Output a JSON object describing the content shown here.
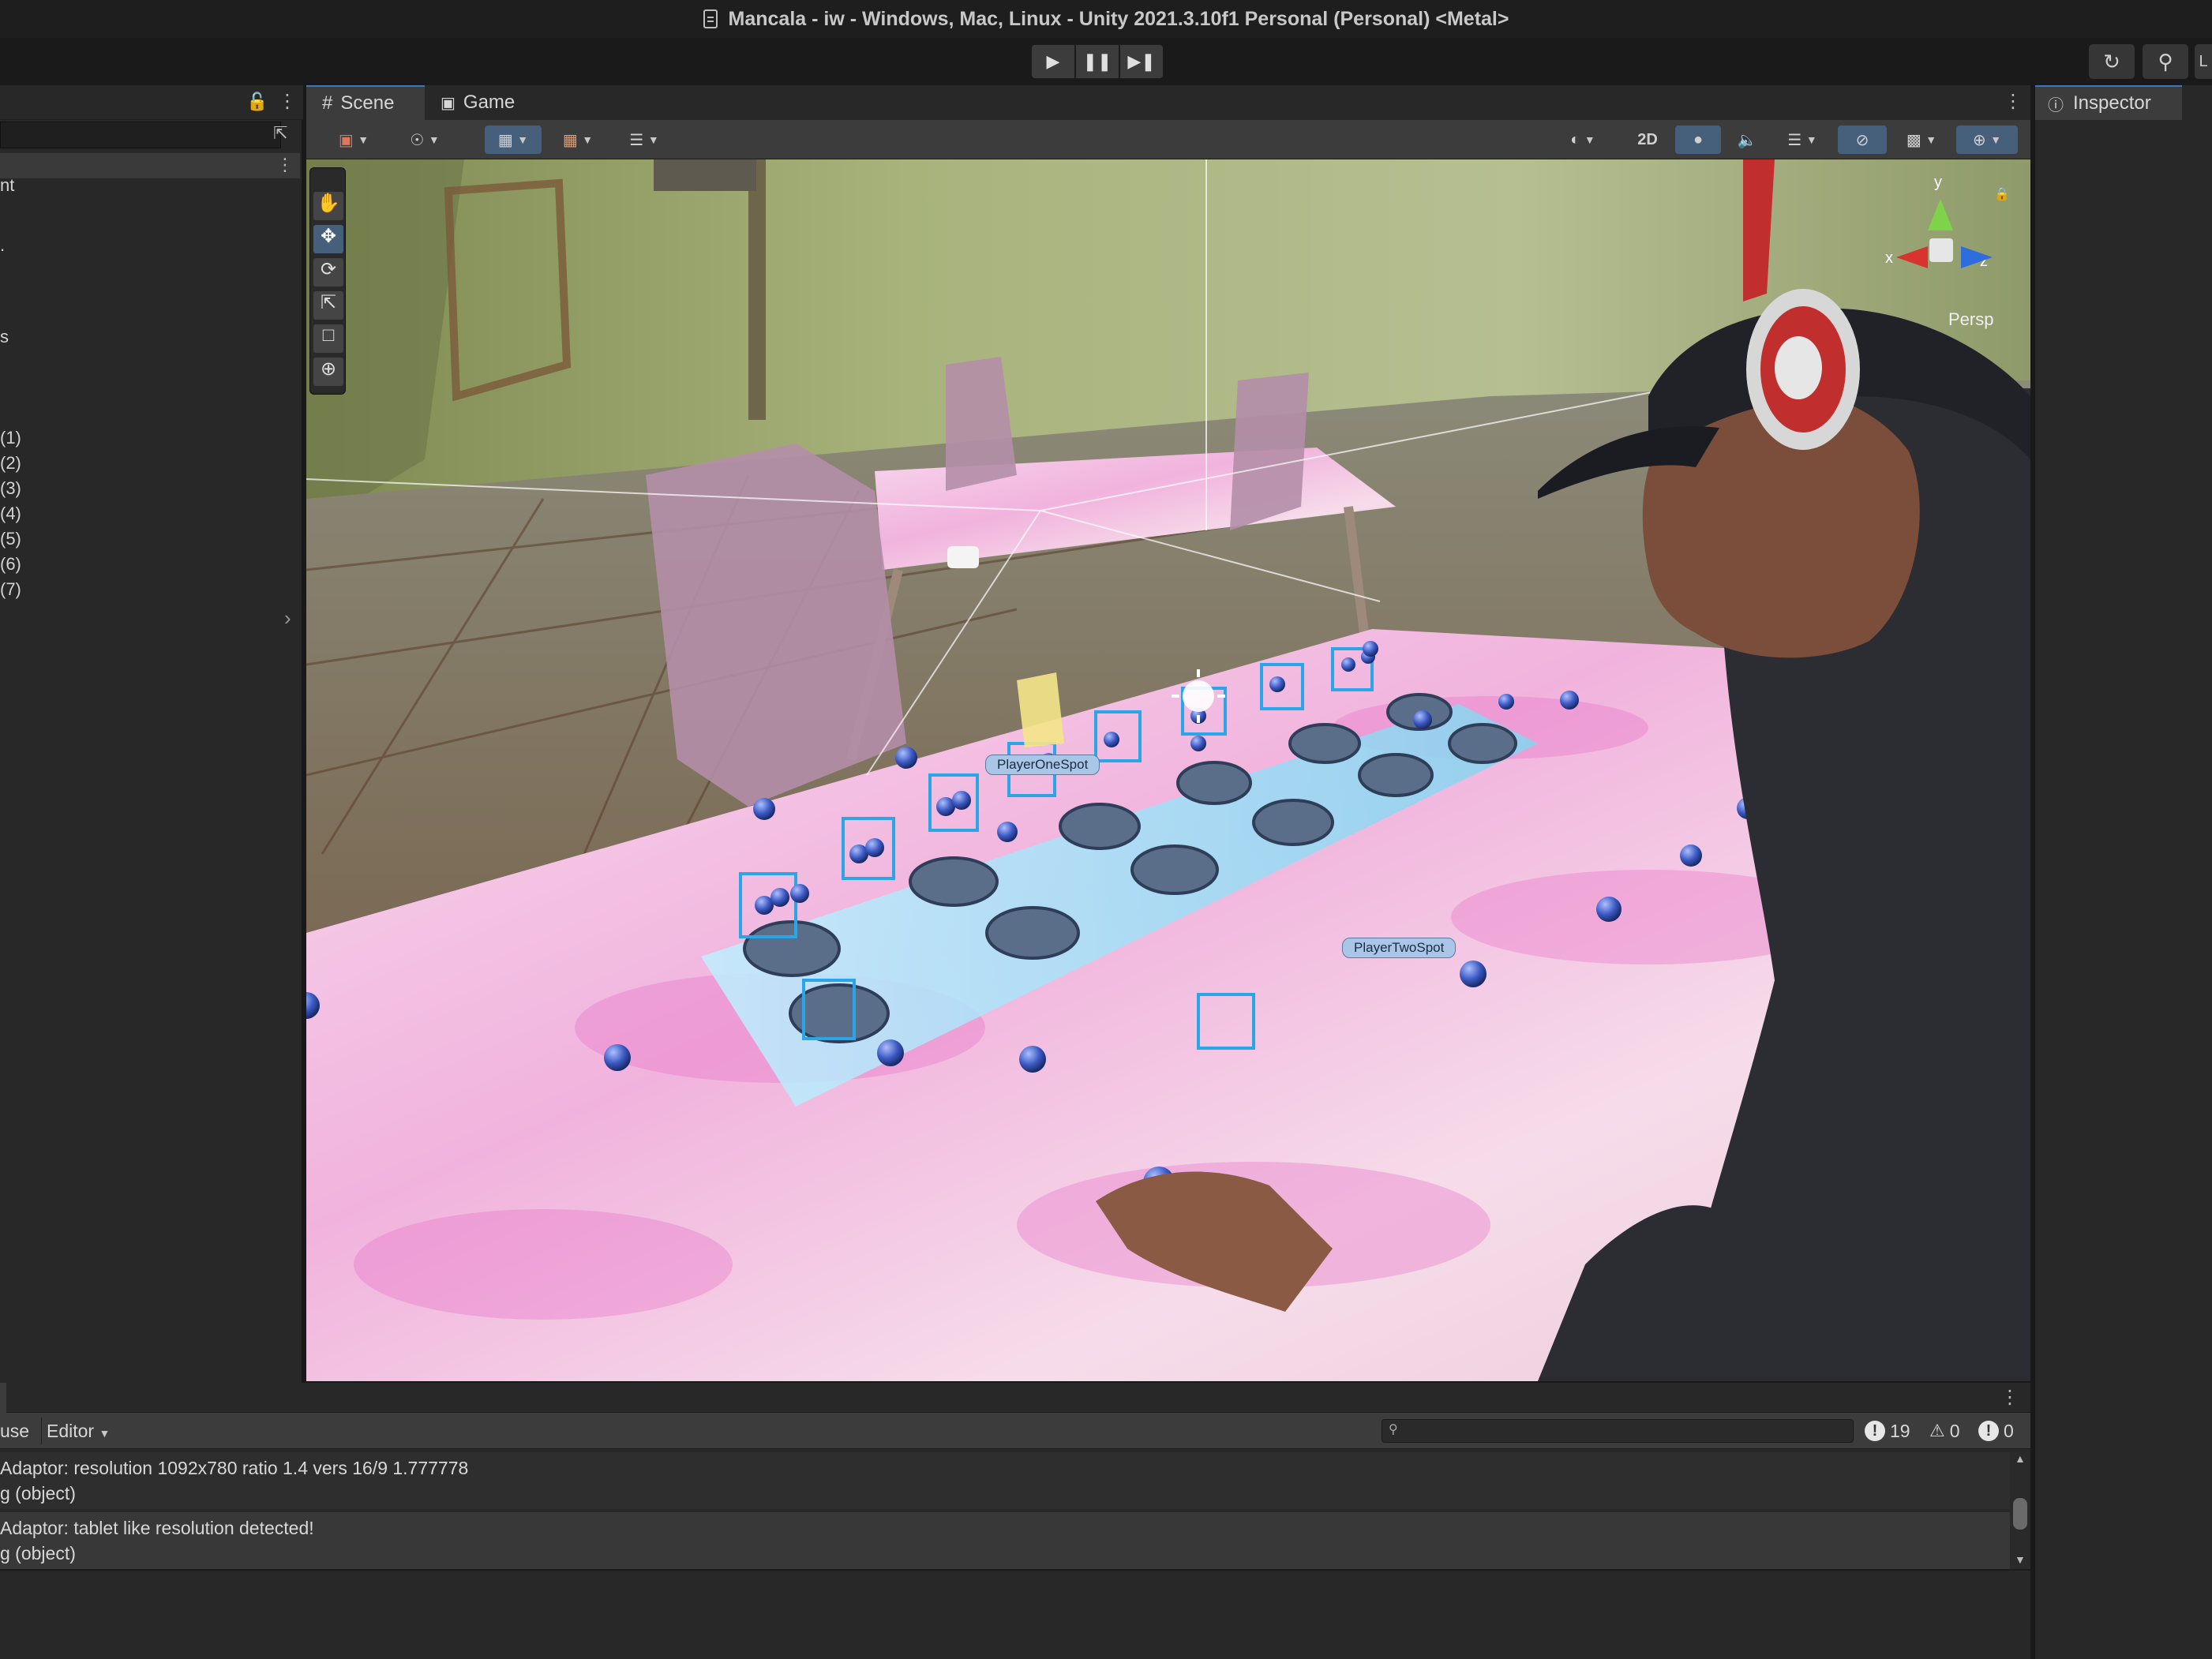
{
  "window": {
    "title": "Mancala - iw - Windows, Mac, Linux - Unity 2021.3.10f1 Personal (Personal) <Metal>"
  },
  "toolbar": {
    "play_icon": "play-icon",
    "pause_icon": "pause-icon",
    "step_icon": "step-icon",
    "right_icons": [
      "history-icon",
      "search-icon"
    ],
    "right_cut_label": "L"
  },
  "hierarchy": {
    "rows": [
      {
        "label": "nt"
      },
      {
        "label": "."
      },
      {
        "label": "s"
      },
      {
        "label": "(1)"
      },
      {
        "label": "(2)"
      },
      {
        "label": "(3)"
      },
      {
        "label": "(4)"
      },
      {
        "label": "(5)"
      },
      {
        "label": "(6)"
      },
      {
        "label": "(7)"
      }
    ]
  },
  "scene": {
    "tabs": [
      {
        "label": "Scene",
        "icon": "grid-icon",
        "active": true
      },
      {
        "label": "Game",
        "icon": "gamepad-icon",
        "active": false
      }
    ],
    "toolbar": {
      "two_d_label": "2D"
    },
    "tools": [
      "hand-tool-icon",
      "move-tool-icon",
      "rotate-tool-icon",
      "scale-tool-icon",
      "rect-tool-icon",
      "transform-tool-icon"
    ],
    "gizmo": {
      "y": "y",
      "x": "x",
      "z": "z",
      "persp": "Persp"
    },
    "labels": {
      "player_one": "PlayerOneSpot",
      "player_two": "PlayerTwoSpot"
    }
  },
  "inspector": {
    "tab_label": "Inspector"
  },
  "console": {
    "clear_label": "use",
    "editor_label": "Editor",
    "search_placeholder": "",
    "error_count": "19",
    "warning_count": "0",
    "info_count": "0",
    "entries": [
      {
        "line1": "Adaptor: resolution 1092x780 ratio 1.4 vers 16/9 1.777778",
        "line2": "g (object)"
      },
      {
        "line1": "Adaptor: tablet like resolution detected!",
        "line2": "g (object)"
      }
    ]
  },
  "colors": {
    "accent": "#3a79bb",
    "panel": "#282828",
    "toolbar": "#3c3c3c",
    "tablecloth": "#f0c6e4",
    "board": "#9fe0f4"
  }
}
